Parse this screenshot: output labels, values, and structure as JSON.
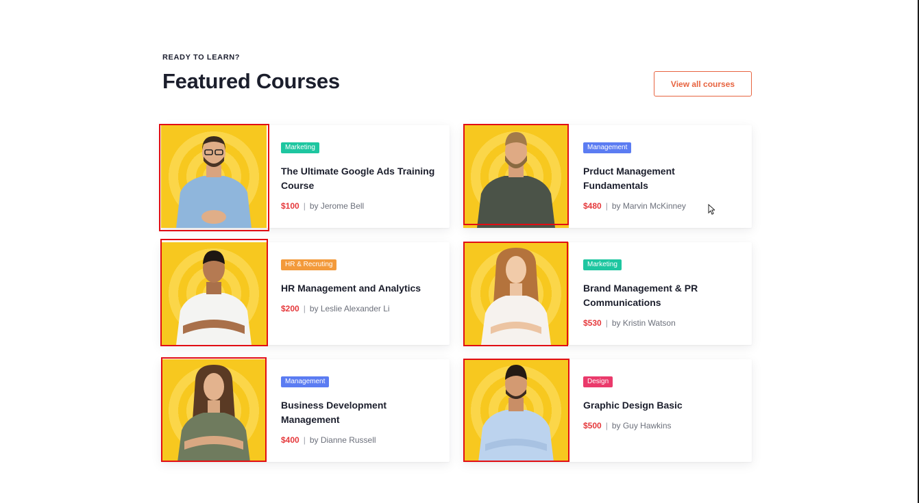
{
  "header": {
    "eyebrow": "READY TO LEARN?",
    "title": "Featured Courses",
    "view_all": "View all courses"
  },
  "colors": {
    "accent": "#e7633f",
    "price": "#e5383b",
    "thumb_bg": "#f7c81f",
    "highlight": "#e10d14"
  },
  "courses": [
    {
      "tag": "Marketing",
      "tag_color": "#1ec6a0",
      "title": "The Ultimate Google Ads Training Course",
      "price": "$100",
      "sep": "|",
      "author": "by Jerome Bell"
    },
    {
      "tag": "Management",
      "tag_color": "#5b7cf2",
      "title": "Prduct Management Fundamentals",
      "price": "$480",
      "sep": "|",
      "author": "by Marvin McKinney"
    },
    {
      "tag": "HR & Recruting",
      "tag_color": "#f39a3b",
      "title": "HR  Management and Analytics",
      "price": "$200",
      "sep": "|",
      "author": "by Leslie Alexander Li"
    },
    {
      "tag": "Marketing",
      "tag_color": "#1ec6a0",
      "title": "Brand Management & PR Communications",
      "price": "$530",
      "sep": "|",
      "author": "by Kristin Watson"
    },
    {
      "tag": "Management",
      "tag_color": "#5b7cf2",
      "title": "Business Development Management",
      "price": "$400",
      "sep": "|",
      "author": "by Dianne Russell"
    },
    {
      "tag": "Design",
      "tag_color": "#ea3a6b",
      "title": "Graphic Design Basic",
      "price": "$500",
      "sep": "|",
      "author": "by Guy Hawkins"
    }
  ]
}
